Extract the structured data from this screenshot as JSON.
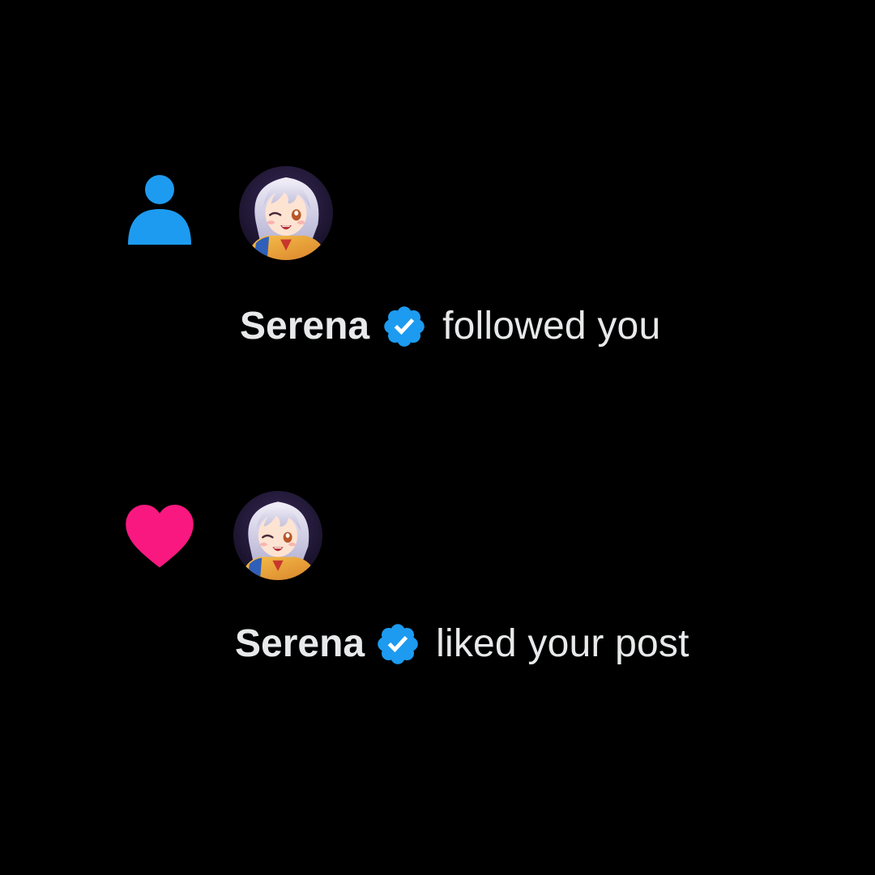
{
  "colors": {
    "background": "#000000",
    "text": "#e7e9ea",
    "follow_icon": "#1d9bf0",
    "like_icon": "#f91880",
    "verified_badge": "#1d9bf0"
  },
  "notifications": [
    {
      "type": "follow",
      "type_icon": "person-icon",
      "avatar": "anime-girl-avatar",
      "user_name": "Serena",
      "verified_icon": "verified-badge-icon",
      "action_text": "followed you"
    },
    {
      "type": "like",
      "type_icon": "heart-icon",
      "avatar": "anime-girl-avatar",
      "user_name": "Serena",
      "verified_icon": "verified-badge-icon",
      "action_text": "liked your post"
    }
  ]
}
